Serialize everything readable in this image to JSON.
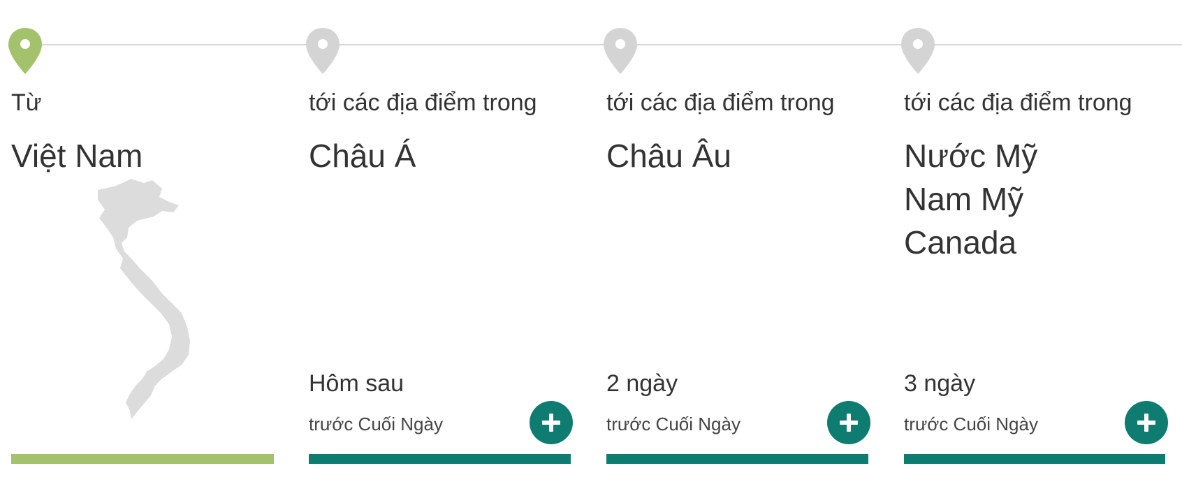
{
  "colors": {
    "origin_accent": "#a4c16c",
    "destination_accent": "#0e7c70",
    "pin_inactive": "#d4d4d4",
    "map_fill": "#dcdcdc"
  },
  "origin": {
    "label": "Từ",
    "country": "Việt Nam",
    "map_icon": "vietnam-map-icon"
  },
  "destinations": [
    {
      "label": "tới các địa điểm trong",
      "regions": [
        "Châu Á"
      ],
      "time_main": "Hôm sau",
      "time_sub": "trước Cuối Ngày"
    },
    {
      "label": "tới các địa điểm trong",
      "regions": [
        "Châu Âu"
      ],
      "time_main": "2 ngày",
      "time_sub": "trước Cuối Ngày"
    },
    {
      "label": "tới các địa điểm trong",
      "regions": [
        "Nước Mỹ",
        "Nam Mỹ",
        "Canada"
      ],
      "time_main": "3 ngày",
      "time_sub": "trước Cuối Ngày"
    }
  ]
}
